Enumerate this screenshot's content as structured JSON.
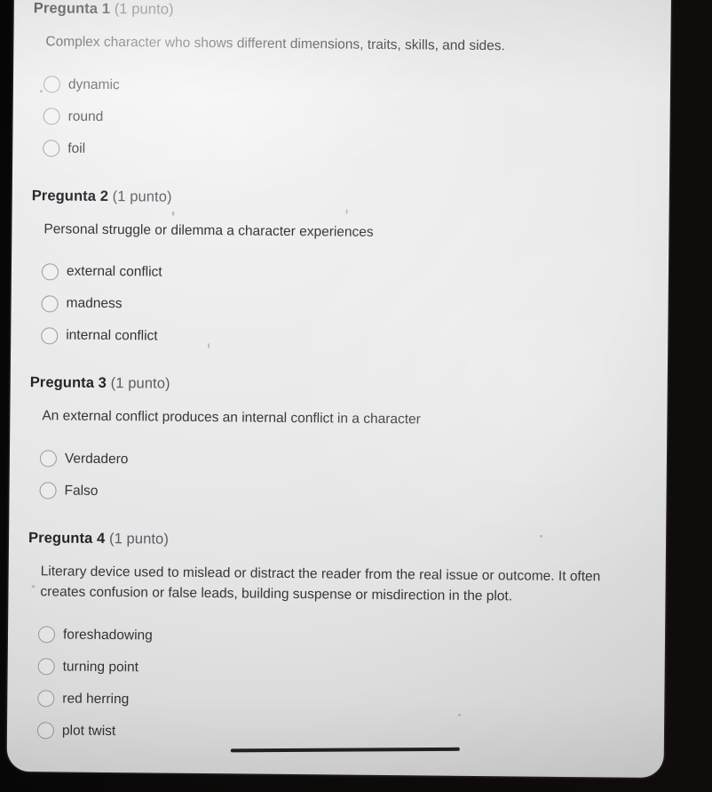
{
  "device": {
    "home_indicator": "home-indicator-bar"
  },
  "quiz": {
    "questions": [
      {
        "label": "Pregunta 1",
        "points": "(1 punto)",
        "prompt": "Complex character who shows different dimensions, traits, skills, and sides.",
        "options": [
          {
            "label": "dynamic",
            "selected": false
          },
          {
            "label": "round",
            "selected": false
          },
          {
            "label": "foil",
            "selected": false
          }
        ]
      },
      {
        "label": "Pregunta 2",
        "points": "(1 punto)",
        "prompt": "Personal struggle or dilemma a character experiences",
        "options": [
          {
            "label": "external conflict",
            "selected": false
          },
          {
            "label": "madness",
            "selected": false
          },
          {
            "label": "internal conflict",
            "selected": false
          }
        ]
      },
      {
        "label": "Pregunta 3",
        "points": "(1 punto)",
        "prompt": "An external conflict produces an internal conflict in a character",
        "options": [
          {
            "label": "Verdadero",
            "selected": false
          },
          {
            "label": "Falso",
            "selected": false
          }
        ]
      },
      {
        "label": "Pregunta 4",
        "points": "(1 punto)",
        "prompt": "Literary device used to mislead or distract the reader from the real issue or outcome. It often creates confusion or false leads, building suspense or misdirection in the plot.",
        "options": [
          {
            "label": "foreshadowing",
            "selected": false
          },
          {
            "label": "turning point",
            "selected": false
          },
          {
            "label": "red herring",
            "selected": false
          },
          {
            "label": "plot twist",
            "selected": false
          }
        ]
      }
    ]
  },
  "colors": {
    "screen_background": "#e8e8e8",
    "bezel": "#0b0909",
    "heading_text": "#24242a",
    "points_text": "#5b5b63",
    "body_text": "#36363c",
    "radio_border": "#9a9aa0"
  }
}
